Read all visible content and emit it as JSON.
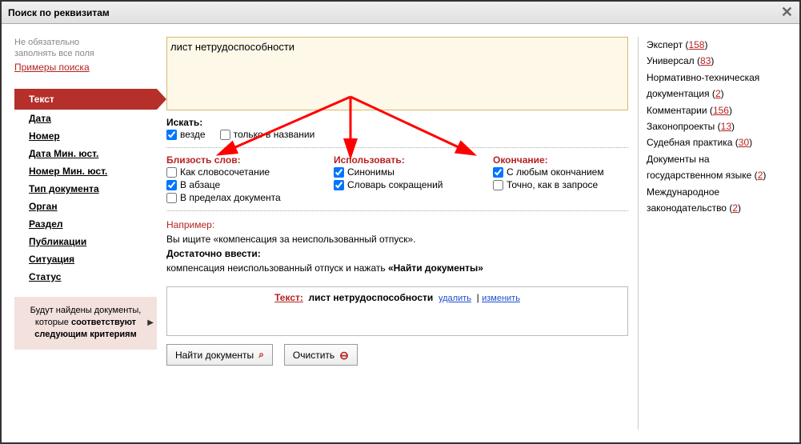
{
  "window": {
    "title": "Поиск по реквизитам"
  },
  "left": {
    "hint1": "Не обязательно",
    "hint2": "заполнять все поля",
    "examples_link": "Примеры поиска",
    "nav": [
      "Текст",
      "Дата",
      "Номер",
      "Дата Мин. юст.",
      "Номер Мин. юст.",
      "Тип документа",
      "Орган",
      "Раздел",
      "Публикации",
      "Ситуация",
      "Статус"
    ],
    "note_p1": "Будут найдены документы,",
    "note_p2a": "которые ",
    "note_p2b": "соответствуют",
    "note_p3": "следующим критериям"
  },
  "main": {
    "query": "лист нетрудоспособности",
    "search_label": "Искать:",
    "chk_everywhere": "везде",
    "chk_title_only": "только в названии",
    "closeness_label": "Близость слов:",
    "chk_phrase": "Как словосочетание",
    "chk_paragraph": "В абзаце",
    "chk_document": "В пределах документа",
    "use_label": "Использовать:",
    "chk_synonyms": "Синонимы",
    "chk_abbrev": "Словарь сокращений",
    "ending_label": "Окончание:",
    "chk_anyending": "С любым окончанием",
    "chk_exact": "Точно, как в запросе",
    "ex_label": "Например:",
    "ex_line1": "Вы ищите «компенсация за неиспользованный отпуск».",
    "ex_bold": "Достаточно ввести:",
    "ex_line2a": "компенсация неиспользованный отпуск и нажать ",
    "ex_line2b": "«Найти документы»",
    "result_tag": "Текст:",
    "result_val": "лист нетрудоспособности",
    "result_del": "удалить",
    "result_edit": "изменить",
    "btn_find": "Найти документы",
    "btn_clear": "Очистить"
  },
  "right": {
    "items": [
      {
        "label": "Эксперт",
        "count": "158"
      },
      {
        "label": "Универсал",
        "count": "83"
      },
      {
        "label": "Нормативно-техническая документация",
        "count": "2"
      },
      {
        "label": "Комментарии",
        "count": "156"
      },
      {
        "label": "Законопроекты",
        "count": "13"
      },
      {
        "label": "Судебная практика",
        "count": "30"
      },
      {
        "label": "Документы на государственном языке",
        "count": "2"
      },
      {
        "label": "Международное законодательство",
        "count": "2"
      }
    ]
  }
}
